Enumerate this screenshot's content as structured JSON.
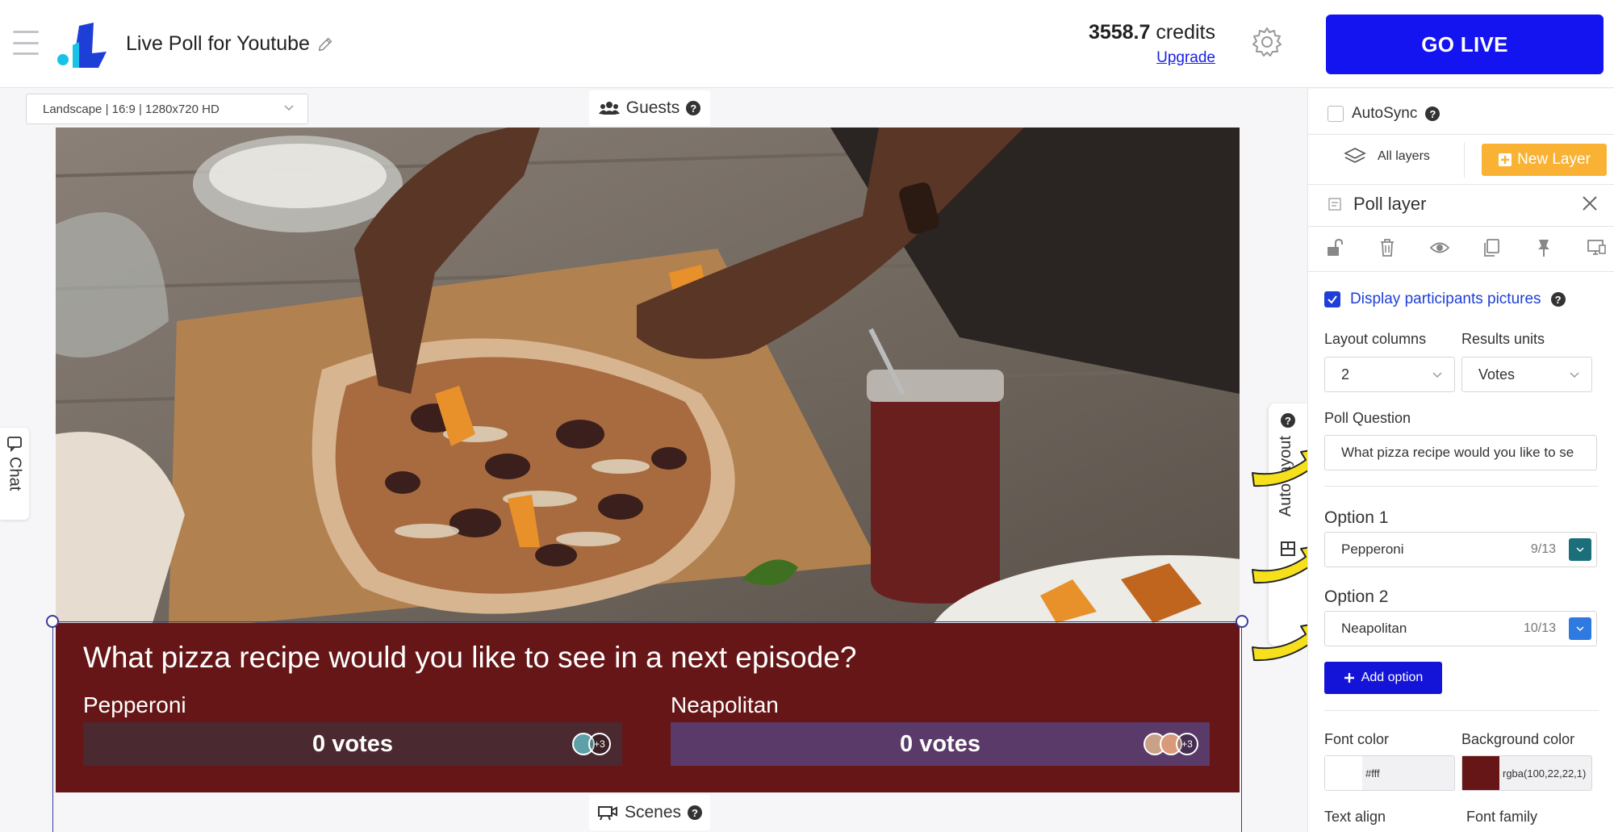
{
  "header": {
    "app_title": "Live Poll for Youtube",
    "credits_amount": "3558.7",
    "credits_unit": "credits",
    "upgrade_label": "Upgrade",
    "go_live_label": "GO LIVE"
  },
  "canvas": {
    "orientation_value": "Landscape | 16:9 | 1280x720 HD",
    "guests_label": "Guests",
    "scenes_label": "Scenes",
    "chat_label": "Chat",
    "autolayout_label": "Auto layout"
  },
  "poll_overlay": {
    "question": "What pizza recipe would you like to see in a next episode?",
    "options": [
      {
        "label": "Pepperoni",
        "votes": "0 votes",
        "more": "+3"
      },
      {
        "label": "Neapolitan",
        "votes": "0 votes",
        "more": "+3"
      }
    ]
  },
  "panel": {
    "autosync_label": "AutoSync",
    "all_layers_label": "All layers",
    "new_layer_label": "New Layer",
    "layer_title": "Poll layer",
    "display_pictures_label": "Display participants pictures",
    "layout_columns_label": "Layout columns",
    "layout_columns_value": "2",
    "results_units_label": "Results units",
    "results_units_value": "Votes",
    "poll_question_label": "Poll Question",
    "poll_question_value": "What pizza recipe would you like to se",
    "option1_title": "Option 1",
    "option1_value": "Pepperoni",
    "option1_count": "9/13",
    "option1_color": "#1a6f7a",
    "option2_title": "Option 2",
    "option2_value": "Neapolitan",
    "option2_count": "10/13",
    "option2_color": "#2f7ae0",
    "add_option_label": "Add option",
    "font_color_label": "Font color",
    "font_color_value": "#fff",
    "background_color_label": "Background color",
    "background_color_value": "rgba(100,22,22,1)",
    "text_align_label": "Text align",
    "font_family_label": "Font family"
  },
  "colors": {
    "accent": "#1414f0",
    "new_layer": "#f9b233",
    "poll_bg": "#661616"
  }
}
